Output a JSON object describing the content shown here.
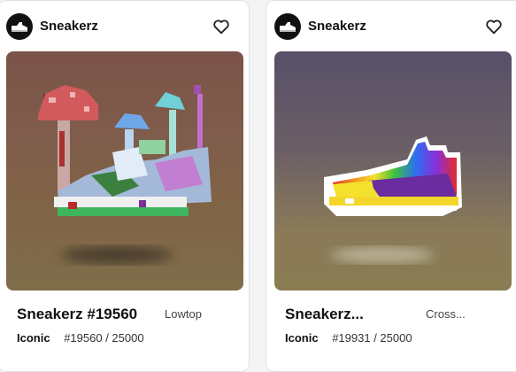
{
  "cards": [
    {
      "collection": "Sneakerz",
      "title": "Sneakerz #19560",
      "trait": "Lowtop",
      "rarity": "Iconic",
      "edition": "#19560 / 25000",
      "icons": {
        "avatar": "sneaker-logo-icon",
        "favorite": "heart-outline-icon"
      },
      "art": "pixel-art-mushroom-sneaker"
    },
    {
      "collection": "Sneakerz",
      "title": "Sneakerz...",
      "trait": "Cross...",
      "rarity": "Iconic",
      "edition": "#19931 / 25000",
      "icons": {
        "avatar": "sneaker-logo-icon",
        "favorite": "heart-outline-icon"
      },
      "art": "pixel-art-rainbow-sneaker"
    }
  ]
}
